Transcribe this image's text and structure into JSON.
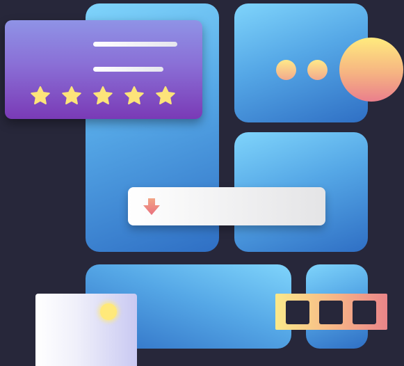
{
  "colors": {
    "background": "#27273a",
    "panel_light": "#7fd4fb",
    "panel_dark": "#2f6fc4",
    "card_top": "#8f93e6",
    "card_bottom": "#7a3ab6",
    "star": "#fde47a",
    "warm_yellow": "#ffeb7e",
    "warm_pink": "#ea7f8c",
    "download_arrow": "#ef8d83"
  },
  "rating_card": {
    "stars_filled": 5,
    "stars_total": 5,
    "icon": "star-icon"
  },
  "download_bar": {
    "icon": "download-arrow-icon"
  },
  "image_card": {
    "icon": "sun-icon"
  },
  "film_strip": {
    "frame_count": 3
  },
  "dots": {
    "count": 2
  }
}
